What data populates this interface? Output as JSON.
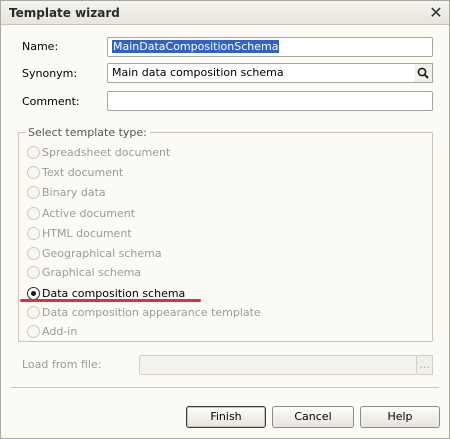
{
  "window": {
    "title": "Template wizard"
  },
  "form": {
    "name_label": "Name:",
    "name_value": "MainDataCompositionSchema",
    "synonym_label": "Synonym:",
    "synonym_value": "Main data composition schema",
    "comment_label": "Comment:",
    "comment_value": ""
  },
  "template_type": {
    "label": "Select template type:",
    "options": [
      {
        "label": "Spreadsheet document",
        "selected": false
      },
      {
        "label": "Text document",
        "selected": false
      },
      {
        "label": "Binary data",
        "selected": false
      },
      {
        "label": "Active document",
        "selected": false
      },
      {
        "label": "HTML document",
        "selected": false
      },
      {
        "label": "Geographical schema",
        "selected": false
      },
      {
        "label": "Graphical schema",
        "selected": false
      },
      {
        "label": "Data composition schema",
        "selected": true
      },
      {
        "label": "Data composition appearance template",
        "selected": false
      },
      {
        "label": "Add-in",
        "selected": false
      }
    ]
  },
  "load": {
    "label": "Load from file:",
    "browse_label": "..."
  },
  "buttons": {
    "finish": "Finish",
    "cancel": "Cancel",
    "help": "Help"
  },
  "colors": {
    "selection": "#3163c5",
    "underline": "#e0303a"
  },
  "icons": {
    "close": "close-icon",
    "search": "search-icon"
  }
}
